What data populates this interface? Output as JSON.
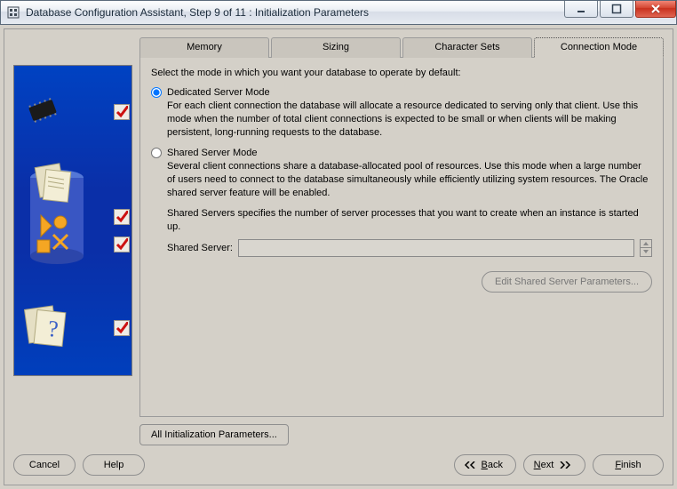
{
  "window": {
    "title": "Database Configuration Assistant, Step 9 of 11 : Initialization Parameters"
  },
  "tabs": {
    "memory": "Memory",
    "sizing": "Sizing",
    "charsets": "Character Sets",
    "connmode": "Connection Mode"
  },
  "intro": "Select the mode in which you want your database to operate by default:",
  "dedicated": {
    "title": "Dedicated Server Mode",
    "desc": "For each client connection the database will allocate a resource dedicated to serving only that client.  Use this mode when the number of total client connections is expected to be small or when clients will be making persistent, long-running requests to the database."
  },
  "shared": {
    "title": "Shared Server Mode",
    "desc": "Several client connections share a database-allocated pool of resources.  Use this mode when a large number of users need to connect to the database simultaneously while efficiently utilizing system resources.  The Oracle shared server feature will be enabled.",
    "note": "Shared Servers specifies the number of server processes that you want to create when an instance is started up.",
    "field_label": "Shared Server:",
    "field_value": ""
  },
  "buttons": {
    "edit_shared": "Edit Shared Server Parameters...",
    "all_params": "All Initialization Parameters...",
    "cancel": "Cancel",
    "help": "Help",
    "back": "Back",
    "next": "Next",
    "finish": "Finish"
  },
  "accel": {
    "back": "B",
    "next": "N",
    "finish": "F"
  }
}
